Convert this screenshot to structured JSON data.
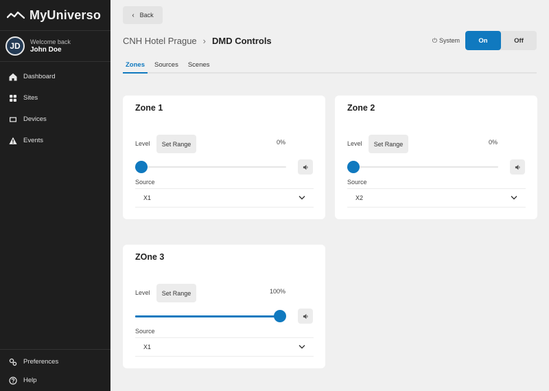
{
  "app": {
    "name": "MyUniverso"
  },
  "user": {
    "initials": "JD",
    "welcome": "Welcome back",
    "name": "John Doe"
  },
  "nav": [
    {
      "label": "Dashboard",
      "icon": "home-icon"
    },
    {
      "label": "Sites",
      "icon": "grid-icon"
    },
    {
      "label": "Devices",
      "icon": "device-icon"
    },
    {
      "label": "Events",
      "icon": "warning-icon"
    }
  ],
  "nav_bottom": [
    {
      "label": "Preferences",
      "icon": "settings-icon"
    },
    {
      "label": "Help",
      "icon": "help-icon"
    }
  ],
  "back": {
    "label": "Back"
  },
  "breadcrumb": {
    "site": "CNH Hotel Prague",
    "page": "DMD Controls"
  },
  "system": {
    "label": "System",
    "on_label": "On",
    "off_label": "Off",
    "state": "on"
  },
  "tabs": [
    {
      "label": "Zones",
      "active": true
    },
    {
      "label": "Sources",
      "active": false
    },
    {
      "label": "Scenes",
      "active": false
    }
  ],
  "zones": [
    {
      "title": "Zone 1",
      "level_label": "Level",
      "range_label": "Set Range",
      "level_text": "0%",
      "level": 0,
      "source_label": "Source",
      "source": "X1"
    },
    {
      "title": "Zone 2",
      "level_label": "Level",
      "range_label": "Set Range",
      "level_text": "0%",
      "level": 0,
      "source_label": "Source",
      "source": "X2"
    },
    {
      "title": "ZOne 3",
      "level_label": "Level",
      "range_label": "Set Range",
      "level_text": "100%",
      "level": 1,
      "source_label": "Source",
      "source": "X1"
    }
  ],
  "colors": {
    "accent": "#1079bf",
    "sidebar": "#1e1e1e",
    "background": "#f0f0f0"
  }
}
